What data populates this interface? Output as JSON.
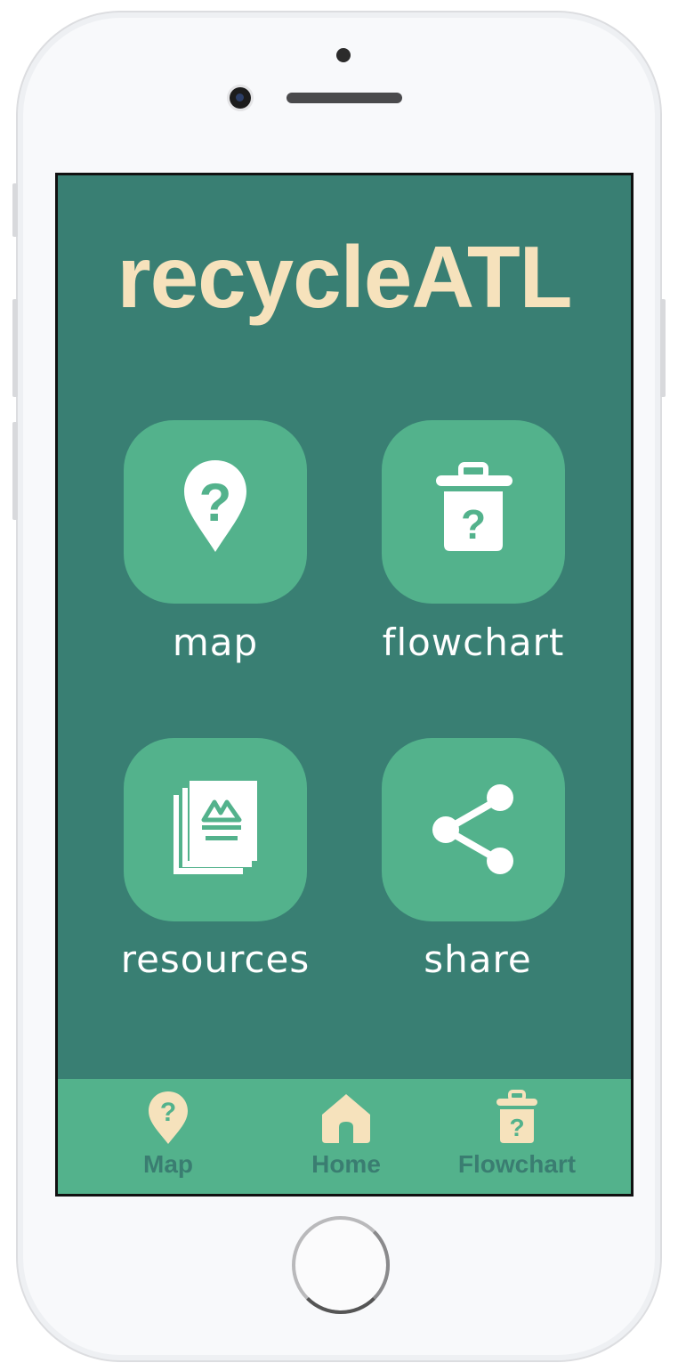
{
  "app": {
    "title": "recycleATL"
  },
  "tiles": [
    {
      "label": "map",
      "icon": "map-pin-question-icon"
    },
    {
      "label": "flowchart",
      "icon": "trash-question-icon"
    },
    {
      "label": "resources",
      "icon": "documents-icon"
    },
    {
      "label": "share",
      "icon": "share-icon"
    }
  ],
  "tabbar": {
    "items": [
      {
        "label": "Map",
        "icon": "map-pin-question-icon"
      },
      {
        "label": "Home",
        "icon": "home-icon"
      },
      {
        "label": "Flowchart",
        "icon": "trash-question-icon"
      }
    ]
  },
  "colors": {
    "background": "#397f73",
    "tile": "#53b28c",
    "title": "#f6e2bc",
    "tab_icon": "#f6e2bc",
    "tab_label": "#3a7d71"
  }
}
